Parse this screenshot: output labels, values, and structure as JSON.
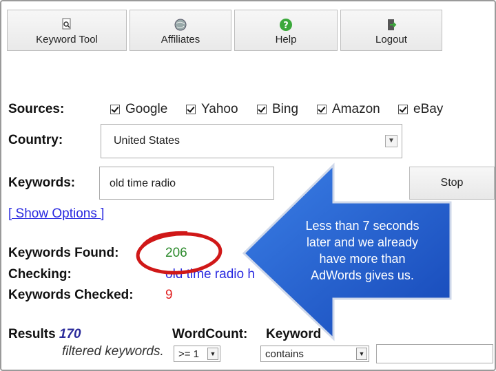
{
  "toolbar": {
    "keyword_tool": "Keyword Tool",
    "affiliates": "Affiliates",
    "help": "Help",
    "logout": "Logout"
  },
  "sources": {
    "label": "Sources:",
    "items": [
      "Google",
      "Yahoo",
      "Bing",
      "Amazon",
      "eBay"
    ]
  },
  "country": {
    "label": "Country:",
    "value": "United States"
  },
  "keywords": {
    "label": "Keywords:",
    "value": "old time radio",
    "stop_label": "Stop"
  },
  "show_options": "[ Show Options ]",
  "stats": {
    "found_label": "Keywords Found:",
    "found_value": "206",
    "checking_label": "Checking:",
    "checking_value": "old time radio h",
    "checked_label": "Keywords Checked:",
    "checked_value": "9"
  },
  "callout": {
    "line1": "Less than 7 seconds",
    "line2": "later and we already",
    "line3": "have more than",
    "line4": "AdWords gives us."
  },
  "results": {
    "label": "Results",
    "count": "170",
    "filtered": "filtered keywords.",
    "wordcount_label": "WordCount:",
    "wordcount_value": ">= 1",
    "keyword_label": "Keyword",
    "keyword_filter": "contains"
  },
  "colors": {
    "found": "#2e8b2e",
    "checked": "#e02020",
    "checking": "#2a2ae0",
    "callout_blue": "#1f5fcf"
  }
}
